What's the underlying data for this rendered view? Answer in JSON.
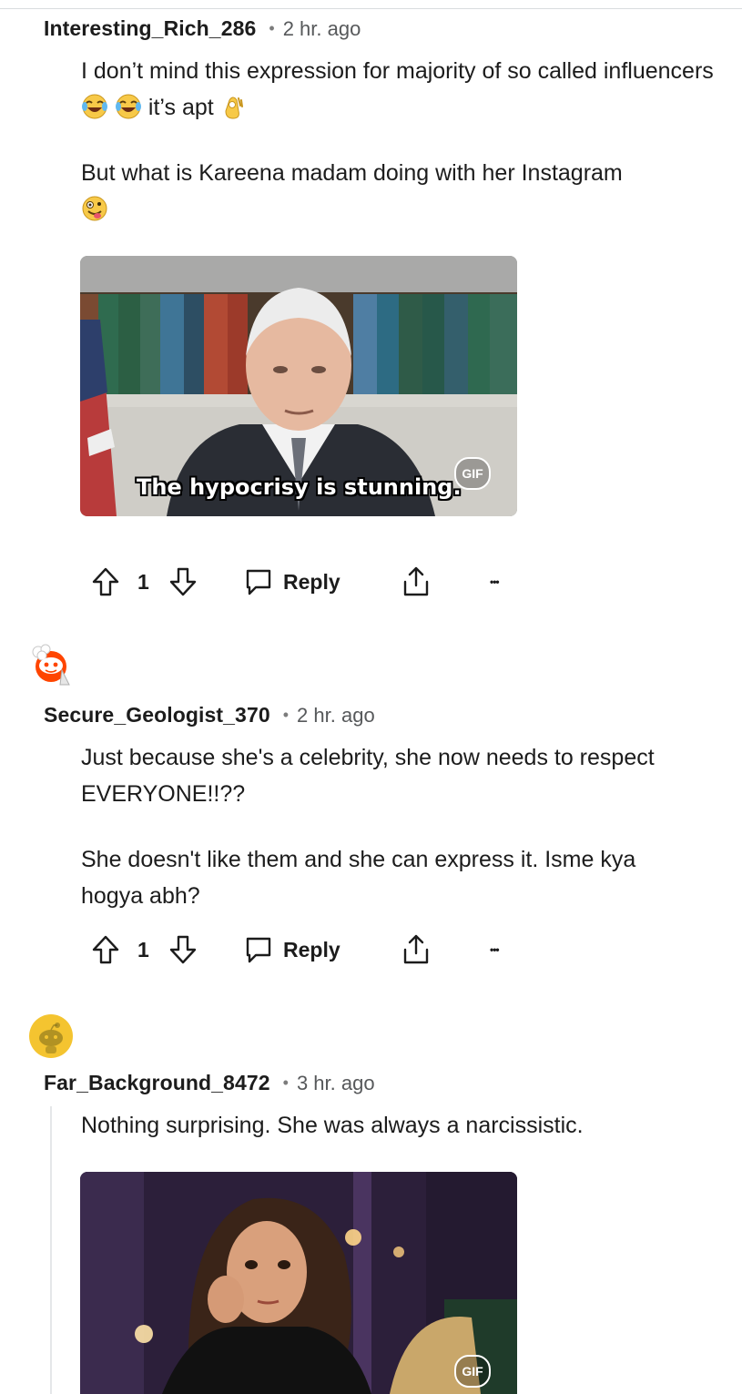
{
  "comments": [
    {
      "username": "Interesting_Rich_286",
      "separator": "•",
      "time": "2 hr. ago",
      "para1_a": "I don’t mind this expression for majority of so called influencers",
      "para1_b": "it’s apt",
      "para2": "But what is Kareena madam doing with her Instagram",
      "gif_caption": "The hypocrisy is stunning.",
      "gif_badge": "GIF",
      "vote_count": "1",
      "reply_label": "Reply",
      "more_label": "•••"
    },
    {
      "username": "Secure_Geologist_370",
      "separator": "•",
      "time": "2 hr. ago",
      "para1": "Just because she's a celebrity, she now needs to respect EVERYONE!!??",
      "para2": "She doesn't like them and she can express it. Isme kya hogya abh?",
      "vote_count": "1",
      "reply_label": "Reply",
      "more_label": "•••"
    },
    {
      "username": "Far_Background_8472",
      "separator": "•",
      "time": "3 hr. ago",
      "para1": "Nothing surprising. She was always a narcissistic.",
      "gif_badge": "GIF"
    }
  ],
  "icons": {
    "upvote": "arrow-up-outline",
    "downvote": "arrow-down-outline",
    "reply": "speech-bubble",
    "share": "share-upload",
    "more": "ellipsis"
  },
  "colors": {
    "text": "#1c1c1c",
    "meta": "#57595b",
    "avatar_red": "#ff4500",
    "avatar_yellow": "#f4c430"
  }
}
